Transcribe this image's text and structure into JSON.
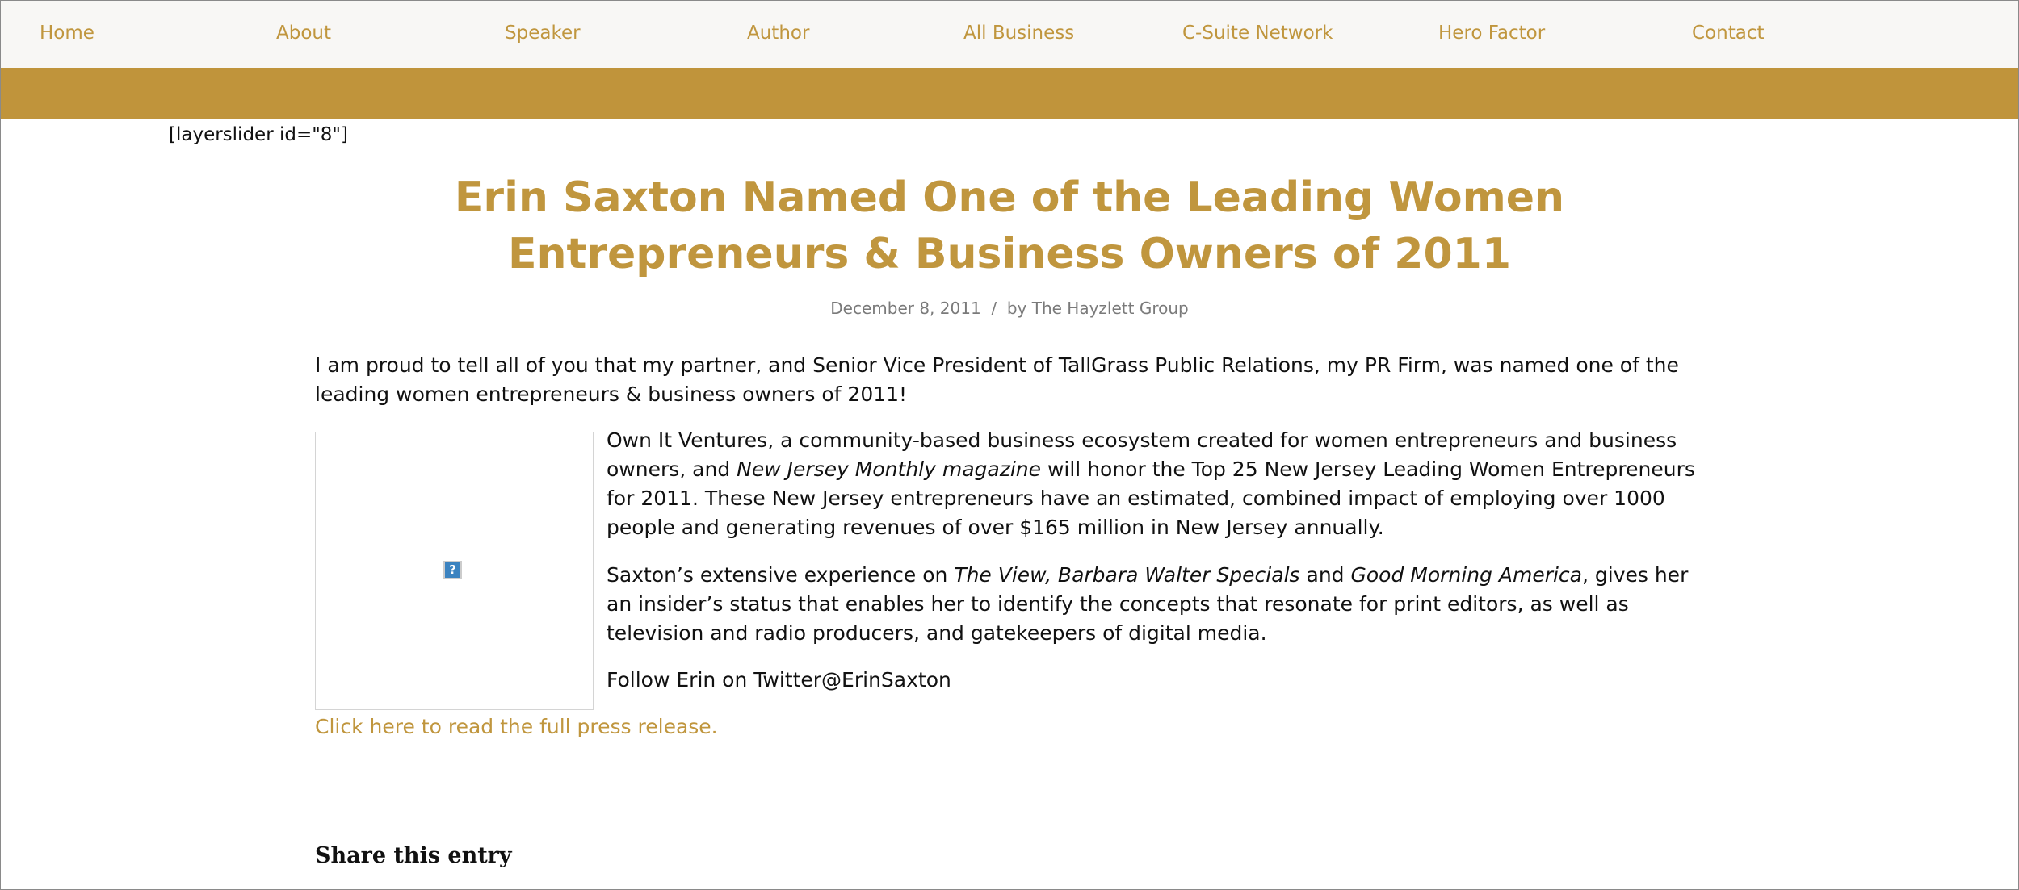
{
  "nav": {
    "items": [
      "Home",
      "About",
      "Speaker",
      "Author",
      "All Business",
      "C-Suite Network",
      "Hero Factor",
      "Contact"
    ]
  },
  "shortcode": "[layerslider id=\"8\"]",
  "post": {
    "title_line1": "Erin Saxton Named One of the Leading Women",
    "title_line2": "Entrepreneurs & Business Owners of 2011",
    "date": "December 8, 2011",
    "separator": "/",
    "by": "by The Hayzlett Group",
    "intro": "I am proud to tell all of you that my partner, and Senior Vice President of TallGrass Public Relations, my PR Firm, was named one of the leading women entrepreneurs & business owners of 2011!",
    "p1_a": "Own It Ventures, a community-based business ecosystem created for women entrepreneurs and business owners, and ",
    "p1_em": "New Jersey Monthly magazine",
    "p1_b": " will honor the Top 25 New Jersey Leading Women Entrepreneurs for 2011.   These New Jersey entrepreneurs have an estimated, combined impact of employing over 1000 people and generating revenues of over $165 million in New Jersey annually.",
    "p2_a": "Saxton’s extensive experience on ",
    "p2_em1": "The View, Barbara Walter Specials",
    "p2_b": " and ",
    "p2_em2": "Good Morning America",
    "p2_c": ", gives her an insider’s status that enables her to identify the concepts that resonate for print editors, as well as television and radio producers, and gatekeepers of digital media.",
    "p3": "Follow Erin on Twitter@ErinSaxton",
    "image_placeholder": "?",
    "link": "Click here to read the full press release."
  },
  "share_heading": "Share this entry",
  "colors": {
    "accent": "#c0963e",
    "band": "#c0943b",
    "nav_bg": "#f8f7f5"
  }
}
